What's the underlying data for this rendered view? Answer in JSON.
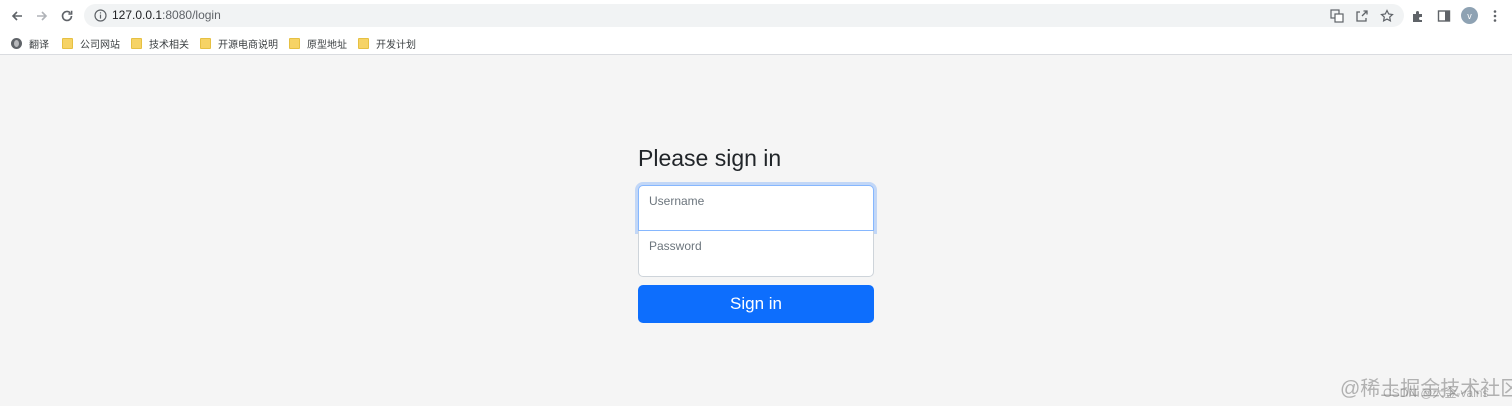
{
  "browser": {
    "url_host": "127.0.0.1",
    "url_path": ":8080/login",
    "profile_initial": "v",
    "icons": {
      "back": "arrow-left-icon",
      "forward": "arrow-right-icon",
      "reload": "reload-icon",
      "site_info": "info-icon",
      "translate": "translate-icon",
      "share": "share-icon",
      "bookmark": "star-icon",
      "extensions": "puzzle-icon",
      "side_panel": "side-panel-icon",
      "menu": "kebab-menu-icon"
    }
  },
  "bookmarks": [
    {
      "label": "翻译",
      "icon": "globe-icon"
    },
    {
      "label": "公司网站",
      "icon": "folder-icon"
    },
    {
      "label": "技术相关",
      "icon": "folder-icon"
    },
    {
      "label": "开源电商说明",
      "icon": "folder-icon"
    },
    {
      "label": "原型地址",
      "icon": "folder-icon"
    },
    {
      "label": "开发计划",
      "icon": "folder-icon"
    }
  ],
  "login": {
    "title": "Please sign in",
    "username_placeholder": "Username",
    "password_placeholder": "Password",
    "submit_label": "Sign in"
  },
  "watermark": {
    "main": "@稀土掘金技术社区",
    "sub": "CSDN @大金-vains"
  },
  "colors": {
    "primary": "#0d6efd",
    "page_bg": "#f5f5f5",
    "focus_border": "#86b7fe"
  }
}
